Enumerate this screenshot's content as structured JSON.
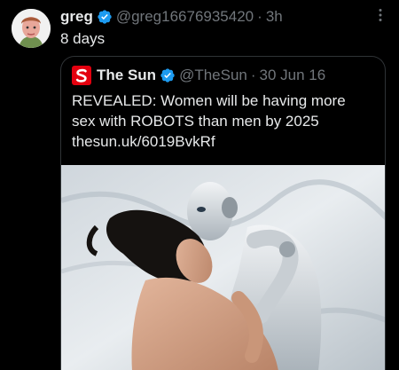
{
  "tweet": {
    "author_name": "greg",
    "author_handle": "@greg16676935420",
    "separator": "·",
    "time": "3h",
    "text": "8 days"
  },
  "quoted": {
    "author_name": "The Sun",
    "author_handle": "@TheSun",
    "separator": "·",
    "date": "30 Jun 16",
    "lines": [
      "REVEALED: Women will be having more",
      "sex with ROBOTS than men by 2025",
      "thesun.uk/6019BvkRf"
    ]
  },
  "colors": {
    "background": "#000000",
    "text": "#e7e9ea",
    "muted": "#71767b",
    "verified": "#1d9bf0",
    "border": "#2f3336",
    "sun_red": "#e3000f"
  },
  "icons": {
    "verified": "verified-badge-icon",
    "more": "more-options-icon",
    "logo": "the-sun-logo"
  }
}
